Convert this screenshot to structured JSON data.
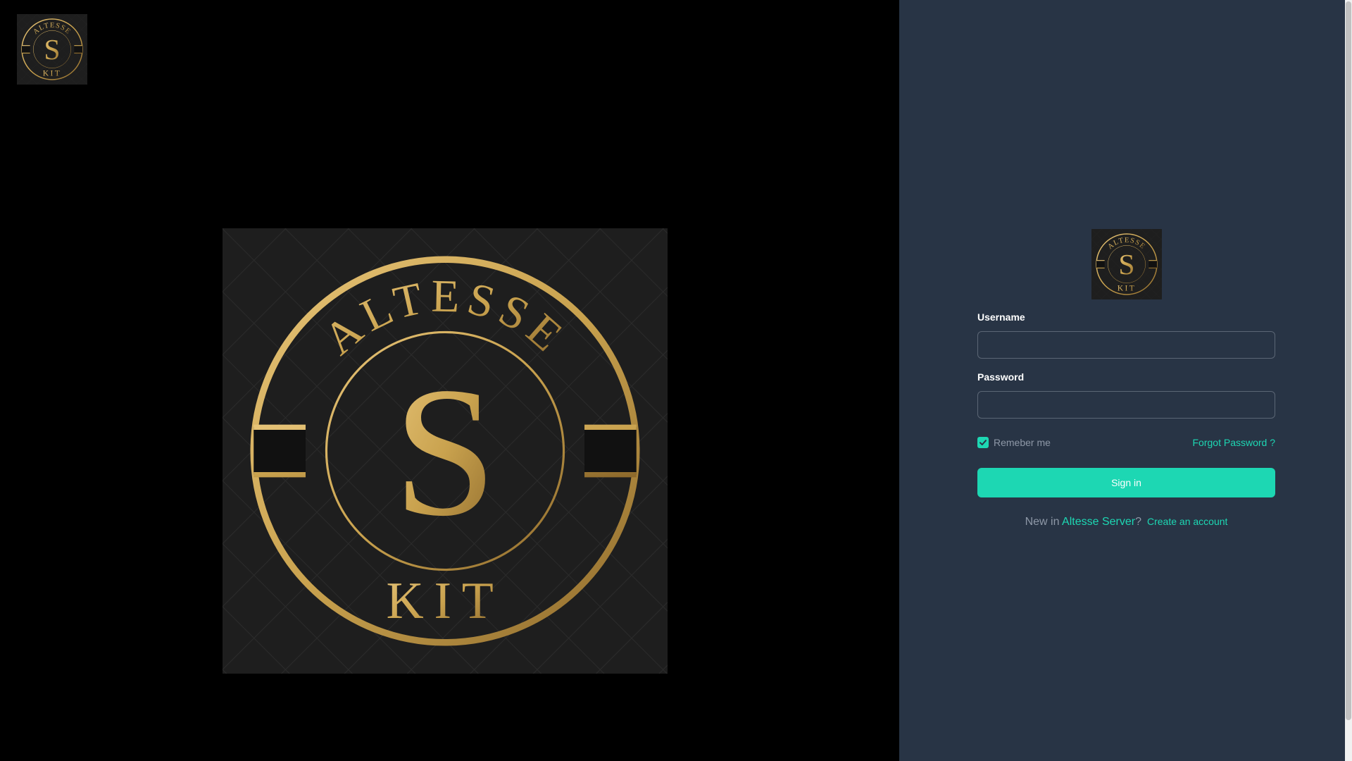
{
  "brand": {
    "logo_icon": "altesse-kit-seal-logo",
    "logo_text_top": "ALTESSE",
    "logo_text_center": "S",
    "logo_text_bottom": "KIT",
    "colors": {
      "gold": "#c9a24e",
      "accent": "#1dd7b3",
      "panel": "#283445"
    }
  },
  "login": {
    "username_label": "Username",
    "username_value": "",
    "password_label": "Password",
    "password_value": "",
    "remember_label": "Remeber me",
    "remember_checked": true,
    "forgot_label": "Forgot Password ?",
    "signin_label": "Sign in",
    "signup_prefix": "New in ",
    "signup_brand": "Altesse Server",
    "signup_q": "?",
    "create_account_label": "Create an account"
  }
}
